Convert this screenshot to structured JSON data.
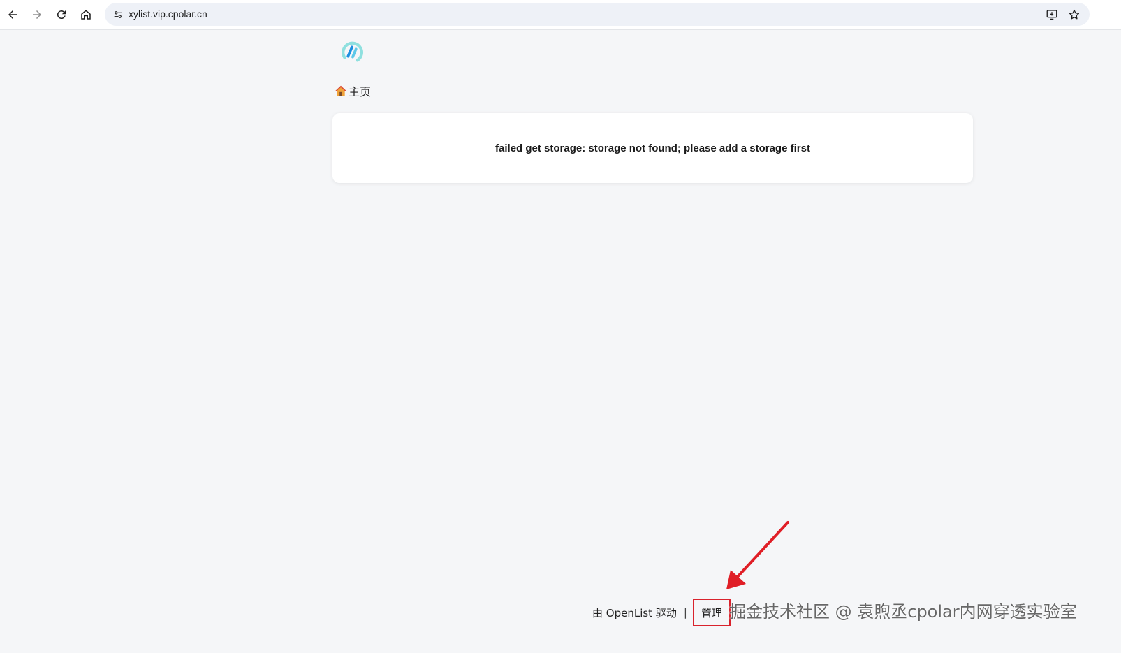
{
  "browser": {
    "url": "xylist.vip.cpolar.cn",
    "icons": {
      "back": "arrow-left-icon",
      "forward": "arrow-right-icon",
      "reload": "reload-icon",
      "home": "home-icon",
      "site_info": "tune-icon",
      "install": "install-app-icon",
      "bookmark": "star-icon"
    }
  },
  "page": {
    "logo": "openlist-logo",
    "breadcrumb": {
      "icon": "house-icon",
      "label": "主页"
    },
    "message": "failed get storage: storage not found; please add a storage first",
    "footer": {
      "powered_by": "由 OpenList 驱动",
      "separator": "|",
      "manage_label": "管理"
    }
  },
  "annotation": {
    "highlight_color": "#d9232d",
    "arrow_color": "#e01e26",
    "watermark": "掘金技术社区 @ 袁煦丞cpolar内网穿透实验室"
  }
}
